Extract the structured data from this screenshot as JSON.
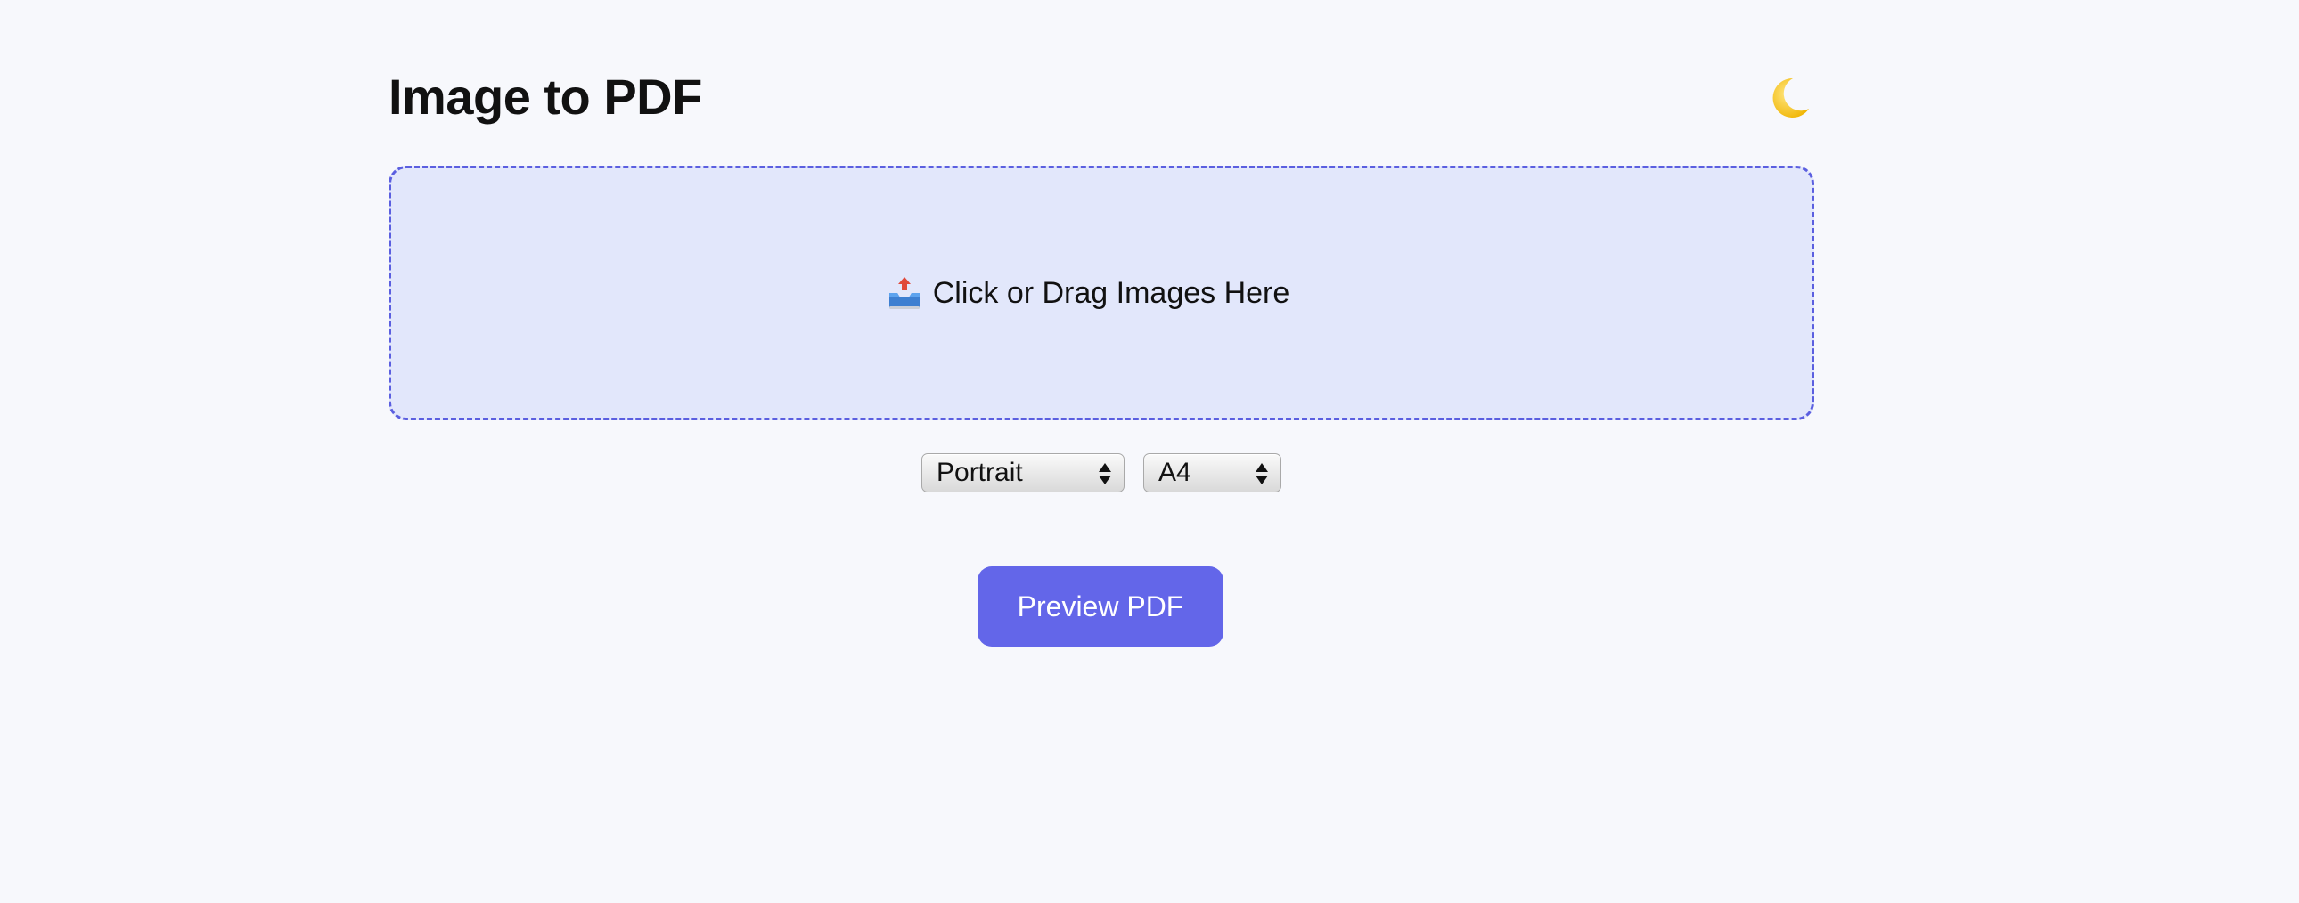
{
  "header": {
    "title": "Image to PDF",
    "theme_toggle_icon": "moon-icon"
  },
  "dropzone": {
    "icon": "inbox-tray-icon",
    "label": "Click or Drag Images Here"
  },
  "options": {
    "orientation": {
      "selected": "Portrait"
    },
    "page_size": {
      "selected": "A4"
    }
  },
  "actions": {
    "preview_label": "Preview PDF"
  },
  "colors": {
    "background": "#f7f8fc",
    "accent": "#6366e9",
    "dropzone_fill": "#e2e7fb",
    "dropzone_border": "#5b5fe0"
  }
}
